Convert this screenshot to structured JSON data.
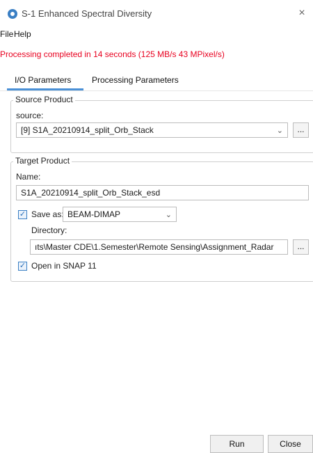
{
  "window": {
    "title": "S-1 Enhanced Spectral Diversity",
    "close_glyph": "×"
  },
  "menu": [
    "File",
    "Help"
  ],
  "status_message": "Processing completed in 14 seconds (125 MB/s 43 MPixel/s)",
  "tabs": [
    {
      "label": "I/O Parameters",
      "active": true
    },
    {
      "label": "Processing Parameters",
      "active": false
    }
  ],
  "source_product": {
    "group_title": "Source Product",
    "source_label": "source:",
    "source_value": "[9] S1A_20210914_split_Orb_Stack",
    "browse_label": "..."
  },
  "target_product": {
    "group_title": "Target Product",
    "name_label": "Name:",
    "name_value": "S1A_20210914_split_Orb_Stack_esd",
    "save_as_label": "Save as:",
    "save_as_checked": true,
    "format_value": "BEAM-DIMAP",
    "directory_label": "Directory:",
    "directory_value": "ıts\\Master CDE\\1.Semester\\Remote Sensing\\Assignment_Radar",
    "browse_label": "...",
    "open_in_snap_label": "Open in SNAP 11",
    "open_in_snap_checked": true
  },
  "buttons": {
    "run": "Run",
    "close": "Close"
  },
  "colors": {
    "status_text": "#e8001f",
    "active_tab_underline": "#4a90d6",
    "checkbox_accent": "#3a7fc4"
  }
}
